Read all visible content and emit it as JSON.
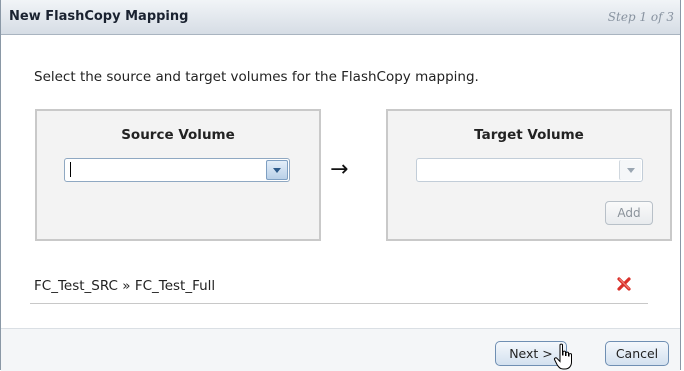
{
  "dialog": {
    "title": "New FlashCopy Mapping",
    "step": "Step 1 of 3"
  },
  "instruction": "Select the source and target volumes for the FlashCopy mapping.",
  "source": {
    "heading": "Source Volume",
    "value": ""
  },
  "arrow": "→",
  "target": {
    "heading": "Target Volume",
    "value": "",
    "add_label": "Add"
  },
  "mappings": [
    {
      "label": "FC_Test_SRC » FC_Test_Full",
      "delete_icon": "red-x-icon"
    }
  ],
  "footer": {
    "next_label": "Next >",
    "cancel_label": "Cancel"
  },
  "colors": {
    "titlebar": "#d6dde5",
    "accent": "#2d5a8a",
    "delete": "#d9302a"
  }
}
